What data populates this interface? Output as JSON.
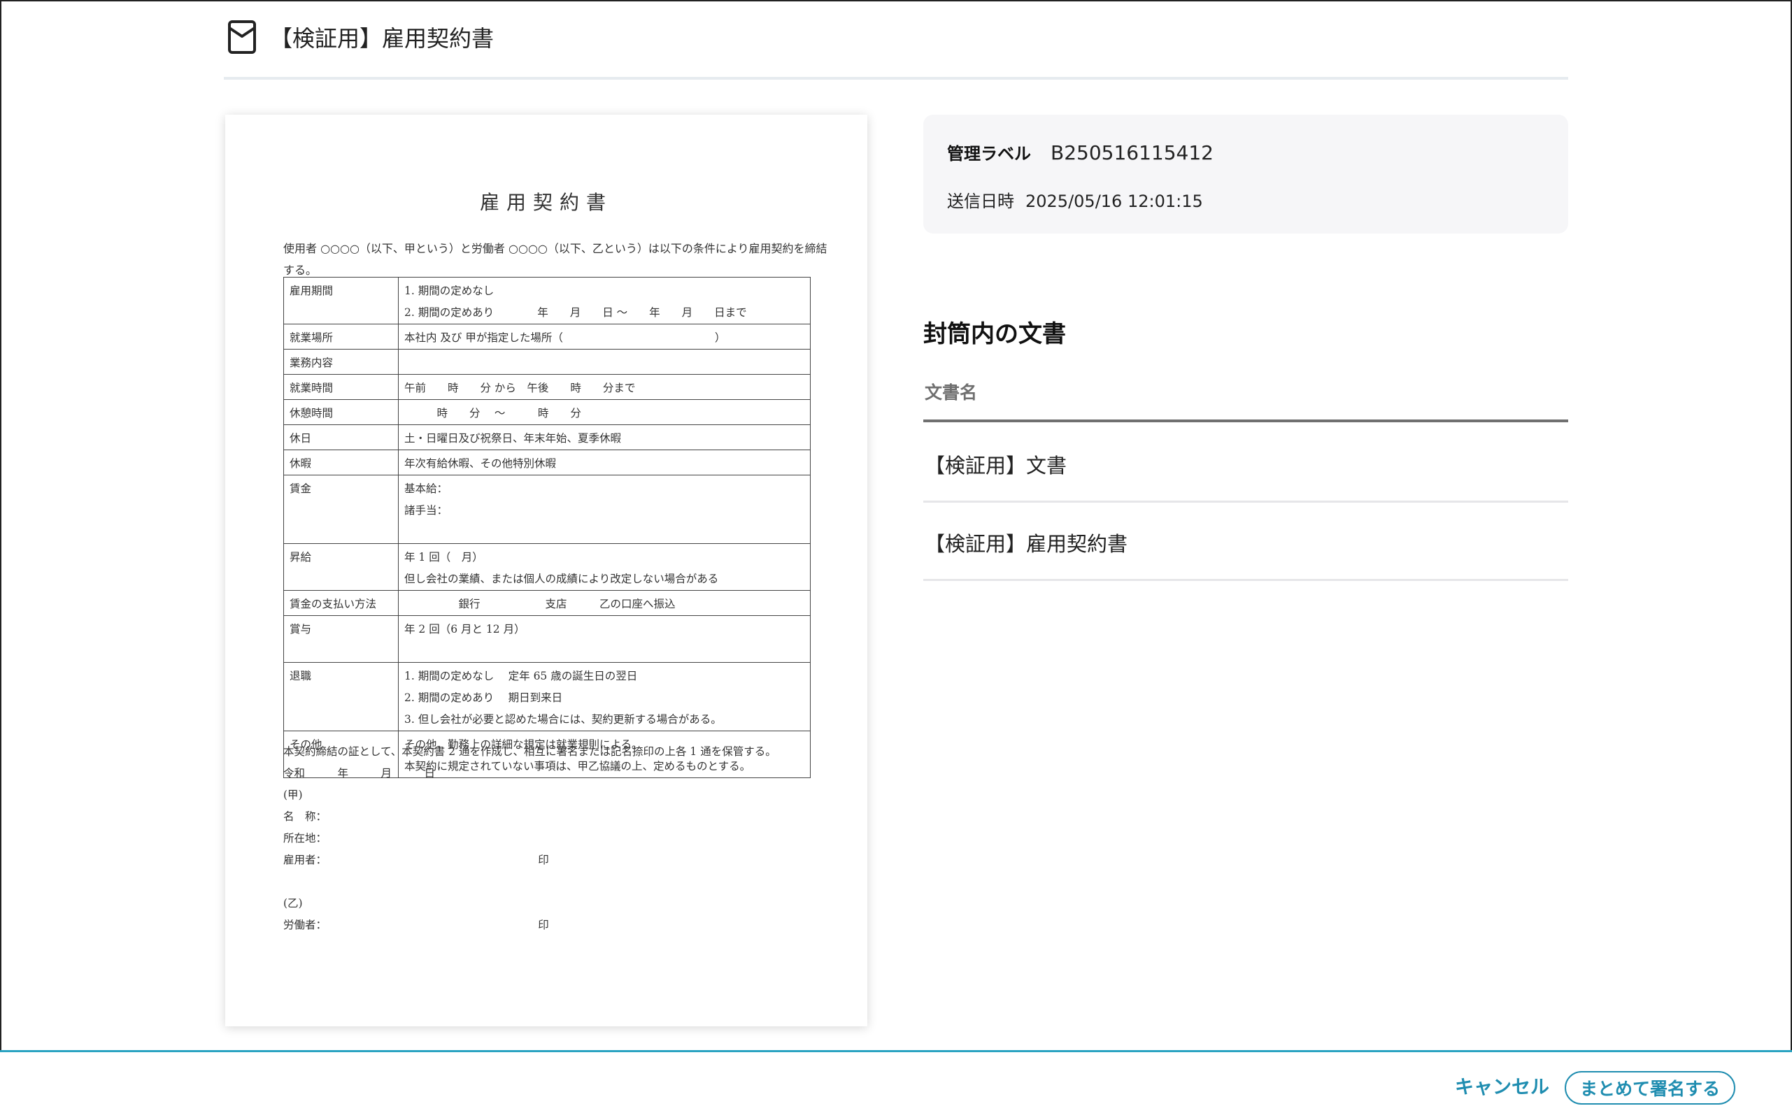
{
  "header": {
    "icon": "envelope-icon",
    "title": "【検証用】雇用契約書"
  },
  "document": {
    "title": "雇用契約書",
    "intro": "使用者 ○○○○（以下、甲という）と労働者 ○○○○（以下、乙という）は以下の条件により雇用契約を締結する。",
    "rows": [
      {
        "label": "雇用期間",
        "lines": [
          "1. 期間の定めなし",
          "2. 期間の定めあり　　　　年　　月　　日 ～　　年　　月　　日まで"
        ]
      },
      {
        "label": "就業場所",
        "lines": [
          "本社内 及び 甲が指定した場所（　　　　　　　　　　　　　　）"
        ]
      },
      {
        "label": "業務内容",
        "lines": [
          ""
        ]
      },
      {
        "label": "就業時間",
        "lines": [
          "午前　　時　　分 から　午後　　時　　分まで"
        ]
      },
      {
        "label": "休憩時間",
        "lines": [
          "　　　時　　分　 ～　　　時　　分"
        ]
      },
      {
        "label": "休日",
        "lines": [
          "土・日曜日及び祝祭日、年末年始、夏季休暇"
        ]
      },
      {
        "label": "休暇",
        "lines": [
          "年次有給休暇、その他特別休暇"
        ]
      },
      {
        "label": "賃金",
        "lines": [
          "基本給：",
          "諸手当：",
          ""
        ]
      },
      {
        "label": "昇給",
        "lines": [
          "年 1 回（　月）",
          "但し会社の業績、または個人の成績により改定しない場合がある"
        ]
      },
      {
        "label": "賃金の支払い方法",
        "lines": [
          "　　　　　銀行　　　　　　支店　　　乙の口座へ振込"
        ]
      },
      {
        "label": "賞与",
        "lines": [
          "年 2 回（6 月と 12 月）",
          ""
        ]
      },
      {
        "label": "退職",
        "lines": [
          "1. 期間の定めなし　 定年 65 歳の誕生日の翌日",
          "2. 期間の定めあり　 期日到来日",
          "3. 但し会社が必要と認めた場合には、契約更新する場合がある。"
        ]
      },
      {
        "label": "その他",
        "lines": [
          "その他、勤務上の詳細な規定は就業規則による。",
          "本契約に規定されていない事項は、甲乙協議の上、定めるものとする。"
        ]
      }
    ],
    "footer_lines": [
      "本契約締結の証として、本契約書 2 通を作成し、相互に署名または記名捺印の上各 1 通を保管する。",
      "令和　　　年　　　月　　　日",
      "(甲)",
      "名　称：",
      "所在地：",
      "雇用者：　　　　　　　　　　　　　　　　　　　　印",
      " ",
      "(乙)",
      "労働者：　　　　　　　　　　　　　　　　　　　　印"
    ]
  },
  "info": {
    "management_label_title": "管理ラベル",
    "management_label_value": "B250516115412",
    "sent_at_title": "送信日時",
    "sent_at_value": "2025/05/16 12:01:15"
  },
  "envelope": {
    "section_title": "封筒内の文書",
    "column_header": "文書名",
    "documents": [
      {
        "name": "【検証用】文書"
      },
      {
        "name": "【検証用】雇用契約書"
      }
    ]
  },
  "actions": {
    "cancel_label": "キャンセル",
    "sign_all_label": "まとめて署名する"
  },
  "colors": {
    "accent": "#1f8db0",
    "footer_border": "#2aa3c1",
    "info_bg": "#f6f6f8"
  }
}
